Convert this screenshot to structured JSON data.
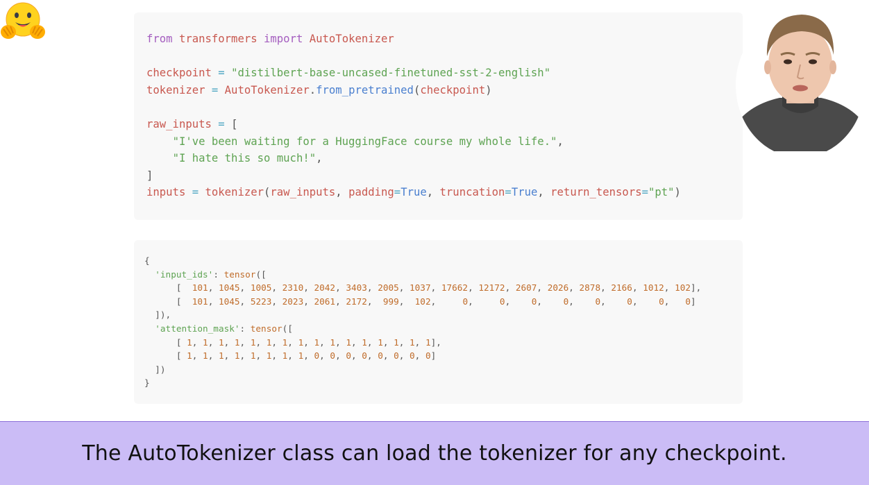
{
  "code": {
    "line1": {
      "kw1": "from",
      "mod": "transformers",
      "kw2": "import",
      "cls": "AutoTokenizer"
    },
    "line3": {
      "var": "checkpoint",
      "eq": "=",
      "str": "\"distilbert-base-uncased-finetuned-sst-2-english\""
    },
    "line4": {
      "var": "tokenizer",
      "eq": "=",
      "cls": "AutoTokenizer",
      "dot": ".",
      "fn": "from_pretrained",
      "open": "(",
      "arg": "checkpoint",
      "close": ")"
    },
    "line6": {
      "var": "raw_inputs",
      "eq": "=",
      "open": "["
    },
    "line7": {
      "str": "\"I've been waiting for a HuggingFace course my whole life.\"",
      "comma": ","
    },
    "line8": {
      "str": "\"I hate this so much!\"",
      "comma": ","
    },
    "line9": {
      "close": "]"
    },
    "line10": {
      "var": "inputs",
      "eq": "=",
      "fn": "tokenizer",
      "open": "(",
      "arg1": "raw_inputs",
      "c1": ",",
      "k1": "padding",
      "e1": "=",
      "v1": "True",
      "c2": ",",
      "k2": "truncation",
      "e2": "=",
      "v2": "True",
      "c3": ",",
      "k3": "return_tensors",
      "e3": "=",
      "v3": "\"pt\"",
      "close": ")"
    }
  },
  "output": {
    "open_brace": "{",
    "input_ids_key": "'input_ids'",
    "colon1": ": ",
    "tensor1": "tensor",
    "t1_open": "([",
    "row1": [
      "101",
      "1045",
      "1005",
      "2310",
      "2042",
      "3403",
      "2005",
      "1037",
      "17662",
      "12172",
      "2607",
      "2026",
      "2878",
      "2166",
      "1012",
      "102"
    ],
    "row2": [
      "101",
      "1045",
      "5223",
      "2023",
      "2061",
      "2172",
      "999",
      "102",
      "0",
      "0",
      "0",
      "0",
      "0",
      "0",
      "0",
      "0"
    ],
    "t1_close": "]),",
    "attention_mask_key": "'attention_mask'",
    "colon2": ": ",
    "tensor2": "tensor",
    "t2_open": "([",
    "row3": [
      "1",
      "1",
      "1",
      "1",
      "1",
      "1",
      "1",
      "1",
      "1",
      "1",
      "1",
      "1",
      "1",
      "1",
      "1",
      "1"
    ],
    "row4": [
      "1",
      "1",
      "1",
      "1",
      "1",
      "1",
      "1",
      "1",
      "0",
      "0",
      "0",
      "0",
      "0",
      "0",
      "0",
      "0"
    ],
    "t2_close": "])",
    "close_brace": "}"
  },
  "caption": "The AutoTokenizer class can load the tokenizer for any checkpoint.",
  "icons": {
    "logo": "hugging-face-logo-icon",
    "presenter": "presenter-webcam"
  },
  "colors": {
    "caption_bg": "#cbbcf6",
    "keyword": "#a45dbf",
    "string": "#5ea352",
    "number": "#c06c2a"
  }
}
